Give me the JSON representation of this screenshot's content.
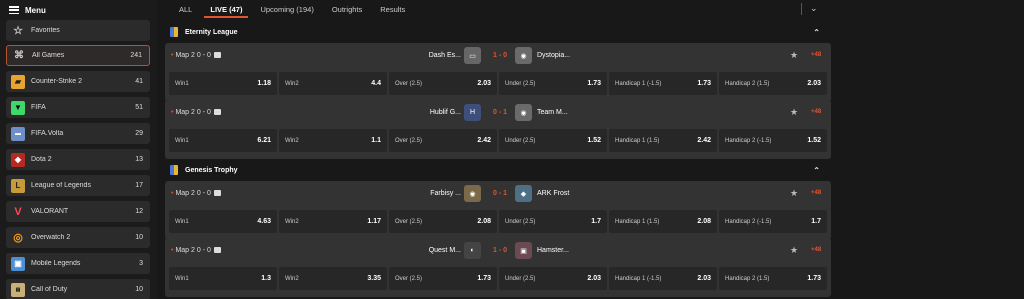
{
  "sidebar": {
    "menu_label": "Menu",
    "items": [
      {
        "label": "Favorites",
        "count": "",
        "icon": "star-icon"
      },
      {
        "label": "All Games",
        "count": "241",
        "icon": "gamepad-icon"
      },
      {
        "label": "Counter-Strike 2",
        "count": "41",
        "icon": "cs2-icon"
      },
      {
        "label": "FIFA",
        "count": "51",
        "icon": "fifa-icon"
      },
      {
        "label": "FIFA.Volta",
        "count": "29",
        "icon": "fifa-volta-icon"
      },
      {
        "label": "Dota 2",
        "count": "13",
        "icon": "dota2-icon"
      },
      {
        "label": "League of Legends",
        "count": "17",
        "icon": "lol-icon"
      },
      {
        "label": "VALORANT",
        "count": "12",
        "icon": "valorant-icon"
      },
      {
        "label": "Overwatch 2",
        "count": "10",
        "icon": "overwatch-icon"
      },
      {
        "label": "Mobile Legends",
        "count": "3",
        "icon": "mobile-legends-icon"
      },
      {
        "label": "Call of Duty",
        "count": "10",
        "icon": "call-of-duty-icon"
      }
    ]
  },
  "tabs": [
    {
      "label": "ALL"
    },
    {
      "label": "LIVE (47)"
    },
    {
      "label": "Upcoming (194)"
    },
    {
      "label": "Outrights"
    },
    {
      "label": "Results"
    }
  ],
  "leagues": [
    {
      "name": "Eternity League"
    },
    {
      "name": "Genesis Trophy"
    }
  ],
  "matches": [
    {
      "map": "Map 2",
      "map_score": "0 - 0",
      "team1": "Dash Es...",
      "score": "1 - 0",
      "team2": "Dystopia...",
      "more": "+48",
      "odds": [
        {
          "l": "Win1",
          "v": "1.18"
        },
        {
          "l": "Win2",
          "v": "4.4"
        },
        {
          "l": "Over (2.5)",
          "v": "2.03"
        },
        {
          "l": "Under (2.5)",
          "v": "1.73"
        },
        {
          "l": "Handicap 1 (-1.5)",
          "v": "1.73"
        },
        {
          "l": "Handicap 2 (1.5)",
          "v": "2.03"
        }
      ]
    },
    {
      "map": "Map 2",
      "map_score": "0 - 0",
      "team1": "Hublif G...",
      "score": "0 - 1",
      "team2": "Team M...",
      "more": "+48",
      "odds": [
        {
          "l": "Win1",
          "v": "6.21"
        },
        {
          "l": "Win2",
          "v": "1.1"
        },
        {
          "l": "Over (2.5)",
          "v": "2.42"
        },
        {
          "l": "Under (2.5)",
          "v": "1.52"
        },
        {
          "l": "Handicap 1 (1.5)",
          "v": "2.42"
        },
        {
          "l": "Handicap 2 (-1.5)",
          "v": "1.52"
        }
      ]
    },
    {
      "map": "Map 2",
      "map_score": "0 - 0",
      "team1": "Farbisy ...",
      "score": "0 - 1",
      "team2": "ARK Frost",
      "more": "+48",
      "odds": [
        {
          "l": "Win1",
          "v": "4.63"
        },
        {
          "l": "Win2",
          "v": "1.17"
        },
        {
          "l": "Over (2.5)",
          "v": "2.08"
        },
        {
          "l": "Under (2.5)",
          "v": "1.7"
        },
        {
          "l": "Handicap 1 (1.5)",
          "v": "2.08"
        },
        {
          "l": "Handicap 2 (-1.5)",
          "v": "1.7"
        }
      ]
    },
    {
      "map": "Map 2",
      "map_score": "0 - 0",
      "team1": "Quest M...",
      "score": "1 - 0",
      "team2": "Hamster...",
      "more": "+48",
      "odds": [
        {
          "l": "Win1",
          "v": "1.3"
        },
        {
          "l": "Win2",
          "v": "3.35"
        },
        {
          "l": "Over (2.5)",
          "v": "1.73"
        },
        {
          "l": "Under (2.5)",
          "v": "2.03"
        },
        {
          "l": "Handicap 1 (-1.5)",
          "v": "2.03"
        },
        {
          "l": "Handicap 2 (1.5)",
          "v": "1.73"
        }
      ]
    }
  ],
  "colors": {
    "accent": "#e2542e",
    "card": "#333333",
    "odd_cell": "#272727",
    "background": "#181818"
  }
}
